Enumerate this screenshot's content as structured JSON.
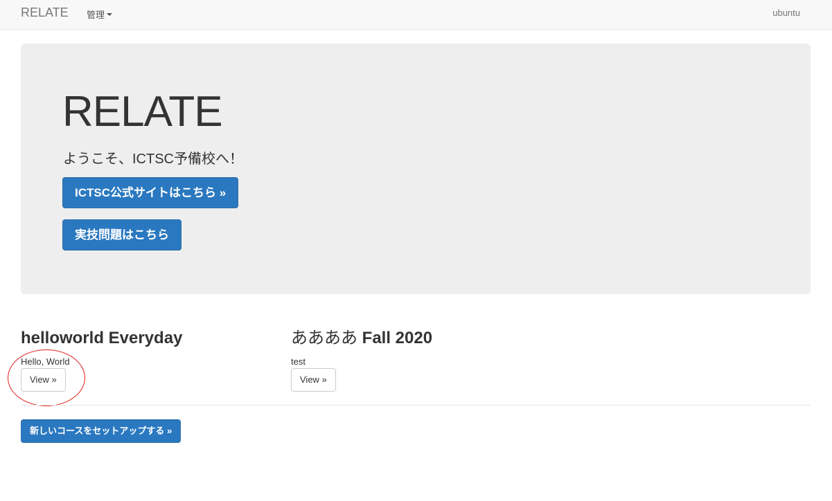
{
  "navbar": {
    "brand": "RELATE",
    "admin_menu": "管理",
    "user": "ubuntu"
  },
  "jumbotron": {
    "title": "RELATE",
    "subtitle": "ようこそ、ICTSC予備校へ！",
    "site_button": "ICTSC公式サイトはこちら »",
    "practice_button": "実技問題はこちら"
  },
  "courses": [
    {
      "title": "helloworld Everyday",
      "description": "Hello, World",
      "view_button": "View »"
    },
    {
      "title_prefix": "ああああ",
      "title_suffix": "Fall 2020",
      "description": "test",
      "view_button": "View »"
    }
  ],
  "setup_button": "新しいコースをセットアップする »",
  "colors": {
    "primary": "#2a78c0",
    "annotation": "#e0231a",
    "jumbotron_bg": "#eeeeee"
  }
}
